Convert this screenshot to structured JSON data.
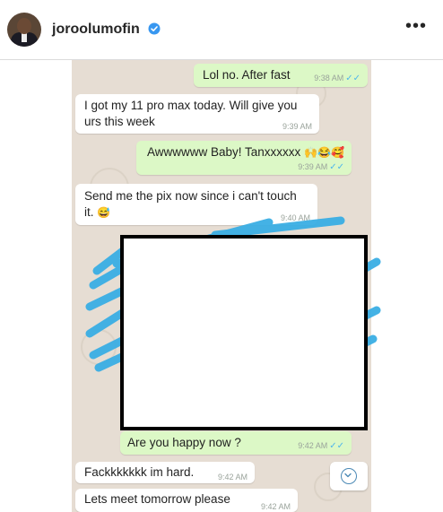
{
  "post": {
    "username": "joroolumofin",
    "verified": true
  },
  "chat": {
    "messages": [
      {
        "side": "out",
        "text": "Lol no. After fast",
        "time": "9:38 AM",
        "status": "read"
      },
      {
        "side": "in",
        "line1": "I got my 11 pro max today. Will give you",
        "line2": "urs this week",
        "time": "9:39 AM"
      },
      {
        "side": "out",
        "text": "Awwwwww Baby! Tanxxxxxx",
        "emoji": "🙌😂🥰",
        "time": "9:39 AM",
        "status": "read"
      },
      {
        "side": "in",
        "line1": "Send me the pix now since i can't touch",
        "line2": "it.",
        "emoji": "😅",
        "time": "9:40 AM"
      },
      {
        "side": "out",
        "text": "Are you happy now ?",
        "time": "9:42 AM",
        "status": "read"
      },
      {
        "side": "in",
        "text": "Fackkkkkkk im hard.",
        "time": "9:42 AM"
      },
      {
        "side": "in",
        "text": "Lets meet tomorrow please",
        "time": "9:42 AM"
      }
    ]
  },
  "colors": {
    "chat_bg": "#e6ddd3",
    "outgoing_bubble": "#dcf8c6",
    "incoming_bubble": "#ffffff",
    "read_ticks": "#4fb6ec",
    "scribble": "#3aaee4",
    "censor_border": "#000000"
  },
  "icons": {
    "verified": "verified-badge-icon",
    "more": "more-options-icon",
    "scroll": "scroll-down-icon"
  }
}
